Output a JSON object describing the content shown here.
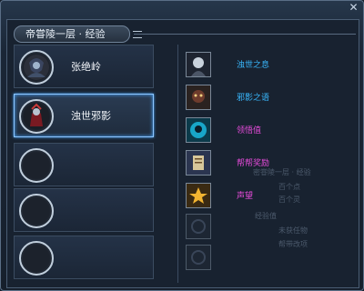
{
  "window": {
    "title": "帝甞陵一层 · 经验",
    "close_glyph": "✕"
  },
  "slots": [
    {
      "name": "张绝岭",
      "state": "filled"
    },
    {
      "name": "浊世邪影",
      "state": "selected"
    },
    {
      "name": "",
      "state": "empty"
    },
    {
      "name": "",
      "state": "empty"
    },
    {
      "name": "",
      "state": "empty"
    }
  ],
  "skills": [
    {
      "label": "浊世之息",
      "color": "#39b9ff",
      "icon": "masked-warrior-icon"
    },
    {
      "label": "邪影之语",
      "color": "#39b9ff",
      "icon": "dark-beast-icon"
    },
    {
      "label": "领悟值",
      "color": "#e34bd8",
      "icon": "blue-spirit-icon"
    },
    {
      "label": "帮帮奖励",
      "color": "#e34bd8",
      "icon": "scroll-icon"
    },
    {
      "label": "声望",
      "color": "#e34bd8",
      "icon": "star-badge-icon"
    },
    {
      "label": "",
      "color": "#5f6c7d",
      "icon": "locked-icon"
    },
    {
      "label": "",
      "color": "#5f6c7d",
      "icon": "locked-icon"
    }
  ],
  "ghost_text": [
    "密甞陵一层 · 经验",
    "百个点",
    "百个灵",
    "经验值",
    "未获任物",
    "帮带改项"
  ],
  "colors": {
    "accent_blue": "#39b9ff",
    "accent_magenta": "#e34bd8",
    "selection_glow": "#8dc6ff"
  }
}
